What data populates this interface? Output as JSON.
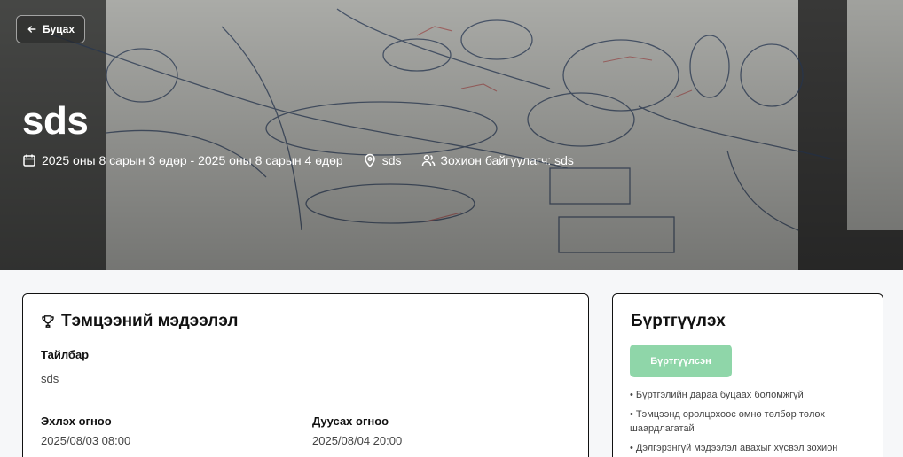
{
  "header": {
    "back_label": "Буцах",
    "event_title": "sds",
    "dates": "2025 оны 8 сарын 3 өдөр - 2025 оны 8 сарын 4 өдөр",
    "location": "sds",
    "organizer": "Зохион байгуулагч: sds"
  },
  "info": {
    "title": "Тэмцээний мэдээлэл",
    "description_label": "Тайлбар",
    "description_value": "sds",
    "start_label": "Эхлэх огноо",
    "start_value": "2025/08/03 08:00",
    "end_label": "Дуусах огноо",
    "end_value": "2025/08/04 20:00"
  },
  "registration": {
    "title": "Бүртгүүлэх",
    "button_label": "Бүртгүүлсэн",
    "notes": [
      "• Бүртгэлийн дараа буцаах боломжгүй",
      "• Тэмцээнд оролцохоос өмнө төлбөр төлөх шаардлагатай",
      "• Дэлгэрэнгүй мэдээлэл авахыг хүсвэл зохион"
    ]
  },
  "colors": {
    "registered_button": "#8fd6a9",
    "page_background": "#f6f7f9"
  },
  "icons": [
    "arrow-left-icon",
    "calendar-icon",
    "map-pin-icon",
    "users-icon",
    "trophy-icon"
  ]
}
